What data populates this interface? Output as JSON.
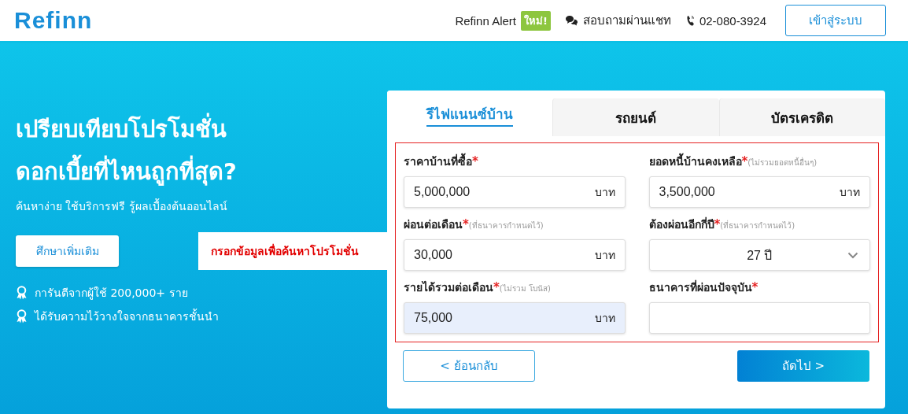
{
  "header": {
    "logo": "Refinn",
    "nav": [
      {
        "kind": "alert",
        "label": "Refinn Alert",
        "badge": "ใหม่!"
      },
      {
        "kind": "chat",
        "label": "สอบถามผ่านแชท"
      },
      {
        "kind": "phone",
        "label": "02-080-3924"
      }
    ],
    "login_button": "เข้าสู่ระบบ"
  },
  "hero": {
    "title_lines": [
      "เปรียบเทียบโปรโมชั่น",
      "ดอกเบี้ยที่ไหนถูกที่สุด?"
    ],
    "subtitle": "ค้นหาง่าย ใช้บริการฟรี รู้ผลเบื้องต้นออนไลน์",
    "button": "ศึกษาเพิ่มเติม",
    "points": [
      "การันตีจากผู้ใช้ 200,000+ ราย",
      "ได้รับความไว้วางใจจากธนาคารชั้นนำ"
    ]
  },
  "callout": "กรอกข้อมูลเพื่อค้นหาโปรโมชั่น",
  "tabs": [
    {
      "label": "รีไฟแนนซ์บ้าน",
      "selected": true
    },
    {
      "label": "รถยนต์",
      "selected": false
    },
    {
      "label": "บัตรเครดิต",
      "selected": false
    }
  ],
  "fields": [
    {
      "label": "ราคาบ้านที่ซื้อ",
      "required_mark": "*",
      "kind": "input",
      "value": "5,000,000",
      "unit": "บาท",
      "autofilled": false
    },
    {
      "label": "ยอดหนี้บ้านคงเหลือ",
      "required_mark": "*",
      "note": "(ไม่รวมยอดหนี้อื่นๆ)",
      "kind": "input",
      "value": "3,500,000",
      "unit": "บาท",
      "autofilled": false
    },
    {
      "label": "ผ่อนต่อเดือน",
      "required_mark": "*",
      "note": "(ที่ธนาคารกำหนดไว้)",
      "kind": "input",
      "value": "30,000",
      "unit": "บาท",
      "autofilled": false
    },
    {
      "label": "ต้องผ่อนอีกกี่ปี",
      "required_mark": "*",
      "note": "(ที่ธนาคารกำหนดไว้)",
      "kind": "select",
      "value": "27 ปี",
      "autofilled": false
    },
    {
      "label": "รายได้รวมต่อเดือน",
      "required_mark": "*",
      "note": "(ไม่รวม โบนัส)",
      "kind": "input",
      "value": "75,000",
      "unit": "บาท",
      "autofilled": true
    },
    {
      "label": "ธนาคารที่ผ่อนปัจจุบัน",
      "required_mark": "*",
      "kind": "input",
      "autofilled": false
    }
  ],
  "back_button": "< ย้อนกลับ",
  "next_button": "ถัดไป >"
}
